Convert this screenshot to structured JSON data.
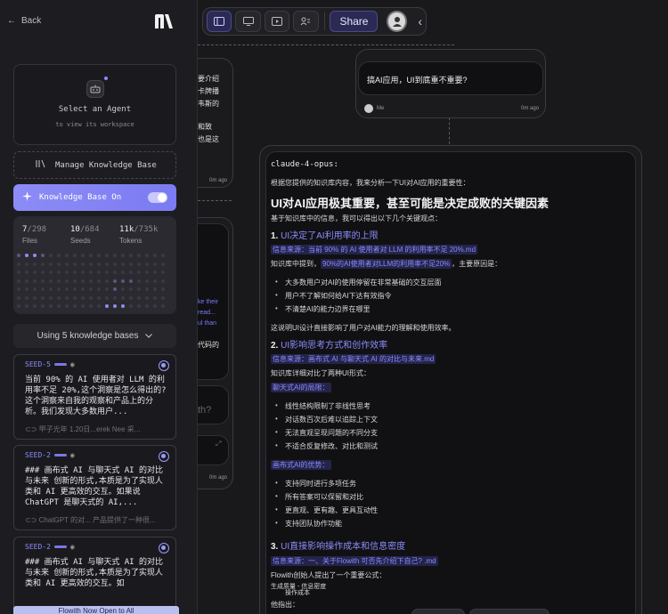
{
  "sidebar": {
    "back_label": "Back",
    "agent_title": "Select an Agent",
    "agent_subtitle": "to view its workspace",
    "manage_kb_label": "Manage Knowledge Base",
    "kb_on_label": "Knowledge Base On",
    "stats": [
      {
        "value": "7",
        "total": "/298",
        "label": "Files"
      },
      {
        "value": "10",
        "total": "/684",
        "label": "Seeds"
      },
      {
        "value": "11k",
        "total": "/735k",
        "label": "Tokens"
      }
    ],
    "using_label": "Using 5 knowledge bases",
    "kb_items": [
      {
        "seed": "SEED-5",
        "body": "当前 90% 的 AI 使用者对 LLM 的利用率不足 20%,这个洞察是怎么得出的?这个洞察来自我的观察和产品上的分析。我们发现大多数用户...",
        "footer": "甲子光年 1.20日...erek Nee 采..."
      },
      {
        "seed": "SEED-2",
        "body": "### 画布式 AI 与聊天式 AI 的对比与未来 创新的形式,本质是为了实现人类和 AI 更高效的交互。如果说 ChatGPT 是聊天式的 AI,...",
        "footer": "ChatGPT 的对... 产品提供了一种很..."
      },
      {
        "seed": "SEED-2",
        "body": "### 画布式 AI 与聊天式 AI 的对比与未来 创新的形式,本质是为了实现人类和 AI 更高效的交互。如",
        "footer": ""
      }
    ],
    "banner": "Flowith Now Open to All"
  },
  "toolbar": {
    "share_label": "Share"
  },
  "question": {
    "text": "搞AI应用，UI到底重不重要?",
    "user": "Me",
    "time": "0m ago"
  },
  "left_nodes": {
    "top_lines": [
      "要介绍",
      "卡牌播",
      "韦斯的",
      "",
      "和致",
      "也是这"
    ],
    "top_time": "0m ago",
    "mid_lines": [
      "ke their",
      "read...",
      "ul than"
    ],
    "mid_line2": "代码的",
    "mid_tail": "th?",
    "mid_time": "0m ago"
  },
  "answer": {
    "model": "claude-4-opus:",
    "intro": "根据您提供的知识库内容，我来分析一下UI对AI应用的重要性：",
    "title": "UI对AI应用极其重要，甚至可能是决定成败的关键因素",
    "lead": "基于知识库中的信息，我可以得出以下几个关键观点：",
    "s1_num": "1.",
    "s1_title": "UI决定了AI利用率的上限",
    "s1_src": "信息来源：当前 90% 的 AI 使用者对 LLM 的利用率不足 20%.md",
    "s1_line_a": "知识库中提到，",
    "s1_line_b": "90%的AI使用者对LLM的利用率不足20%",
    "s1_line_c": "，主要原因是：",
    "s1_bullets": [
      "大多数用户对AI的使用停留在非常基础的交互层面",
      "用户不了解如何给AI下达有效指令",
      "不清楚AI的能力边界在哪里"
    ],
    "s1_tail": "这说明UI设计直接影响了用户对AI能力的理解和使用效率。",
    "s2_num": "2.",
    "s2_title": "UI影响思考方式和创作效率",
    "s2_src": "信息来源：画布式 AI 与聊天式 AI 的对比与未来.md",
    "s2_lead": "知识库详细对比了两种UI形式：",
    "s2_sub1": "聊天式AI的局限：",
    "s2_bullets1": [
      "线性结构限制了非线性思考",
      "对话数百次后难以追踪上下文",
      "无法直观呈现问题的不同分支",
      "不适合反复修改、对比和测试"
    ],
    "s2_sub2": "画布式AI的优势：",
    "s2_bullets2": [
      "支持同时进行多项任务",
      "所有答案可以保留和对比",
      "更直观、更有趣、更具互动性",
      "支持团队协作功能"
    ],
    "s3_num": "3.",
    "s3_title": "UI直接影响操作成本和信息密度",
    "s3_src": "信息来源：一、关于Flowith 可否先介绍下自己? .md",
    "s3_lead": "Flowith创始人提出了一个重要公式：",
    "s3_formula_top": "生成质量 - 信息密度",
    "s3_formula_bottom": "操作成本",
    "s3_tail": "他指出："
  }
}
